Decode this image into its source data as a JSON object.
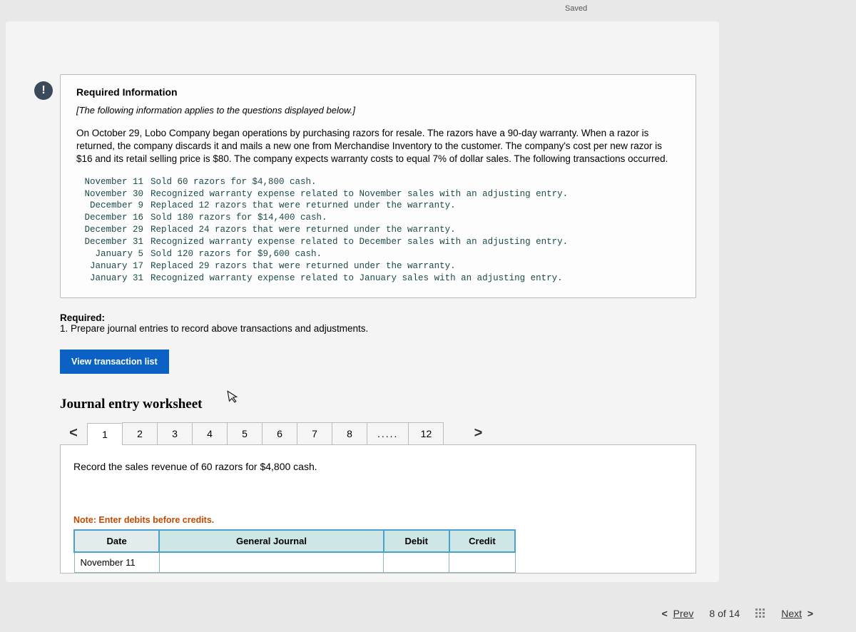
{
  "status": {
    "saved": "Saved"
  },
  "alert_icon_glyph": "!",
  "info": {
    "heading": "Required Information",
    "note": "[The following information applies to the questions displayed below.]",
    "body": "On October 29, Lobo Company began operations by purchasing razors for resale. The razors have a 90-day warranty. When a razor is returned, the company discards it and mails a new one from Merchandise Inventory to the customer. The company's cost per new razor is $16 and its retail selling price is $80. The company expects warranty costs to equal 7% of dollar sales. The following transactions occurred.",
    "transactions": [
      {
        "date": "November 11",
        "desc": "Sold 60 razors for $4,800 cash."
      },
      {
        "date": "November 30",
        "desc": "Recognized warranty expense related to November sales with an adjusting entry."
      },
      {
        "date": "December 9",
        "desc": "Replaced 12 razors that were returned under the warranty."
      },
      {
        "date": "December 16",
        "desc": "Sold 180 razors for $14,400 cash."
      },
      {
        "date": "December 29",
        "desc": "Replaced 24 razors that were returned under the warranty."
      },
      {
        "date": "December 31",
        "desc": "Recognized warranty expense related to December sales with an adjusting entry."
      },
      {
        "date": "January 5",
        "desc": "Sold 120 razors for $9,600 cash."
      },
      {
        "date": "January 17",
        "desc": "Replaced 29 razors that were returned under the warranty."
      },
      {
        "date": "January 31",
        "desc": "Recognized warranty expense related to January sales with an adjusting entry."
      }
    ]
  },
  "required": {
    "label": "Required:",
    "item1": "1. Prepare journal entries to record above transactions and adjustments."
  },
  "buttons": {
    "view_tx_list": "View transaction list"
  },
  "worksheet": {
    "title": "Journal entry worksheet",
    "nav_prev": "<",
    "nav_next": ">",
    "tabs": [
      "1",
      "2",
      "3",
      "4",
      "5",
      "6",
      "7",
      "8",
      ".....",
      "12"
    ],
    "active_tab_index": 0,
    "instruction": "Record the sales revenue of 60 razors for $4,800 cash.",
    "note": "Note: Enter debits before credits.",
    "columns": {
      "date": "Date",
      "gj": "General Journal",
      "debit": "Debit",
      "credit": "Credit"
    },
    "rows": [
      {
        "date": "November 11",
        "gj": "",
        "debit": "",
        "credit": ""
      }
    ]
  },
  "footer": {
    "prev_label": "Prev",
    "prev_chev": "<",
    "position": "8 of 14",
    "next_label": "Next",
    "next_chev": ">"
  }
}
